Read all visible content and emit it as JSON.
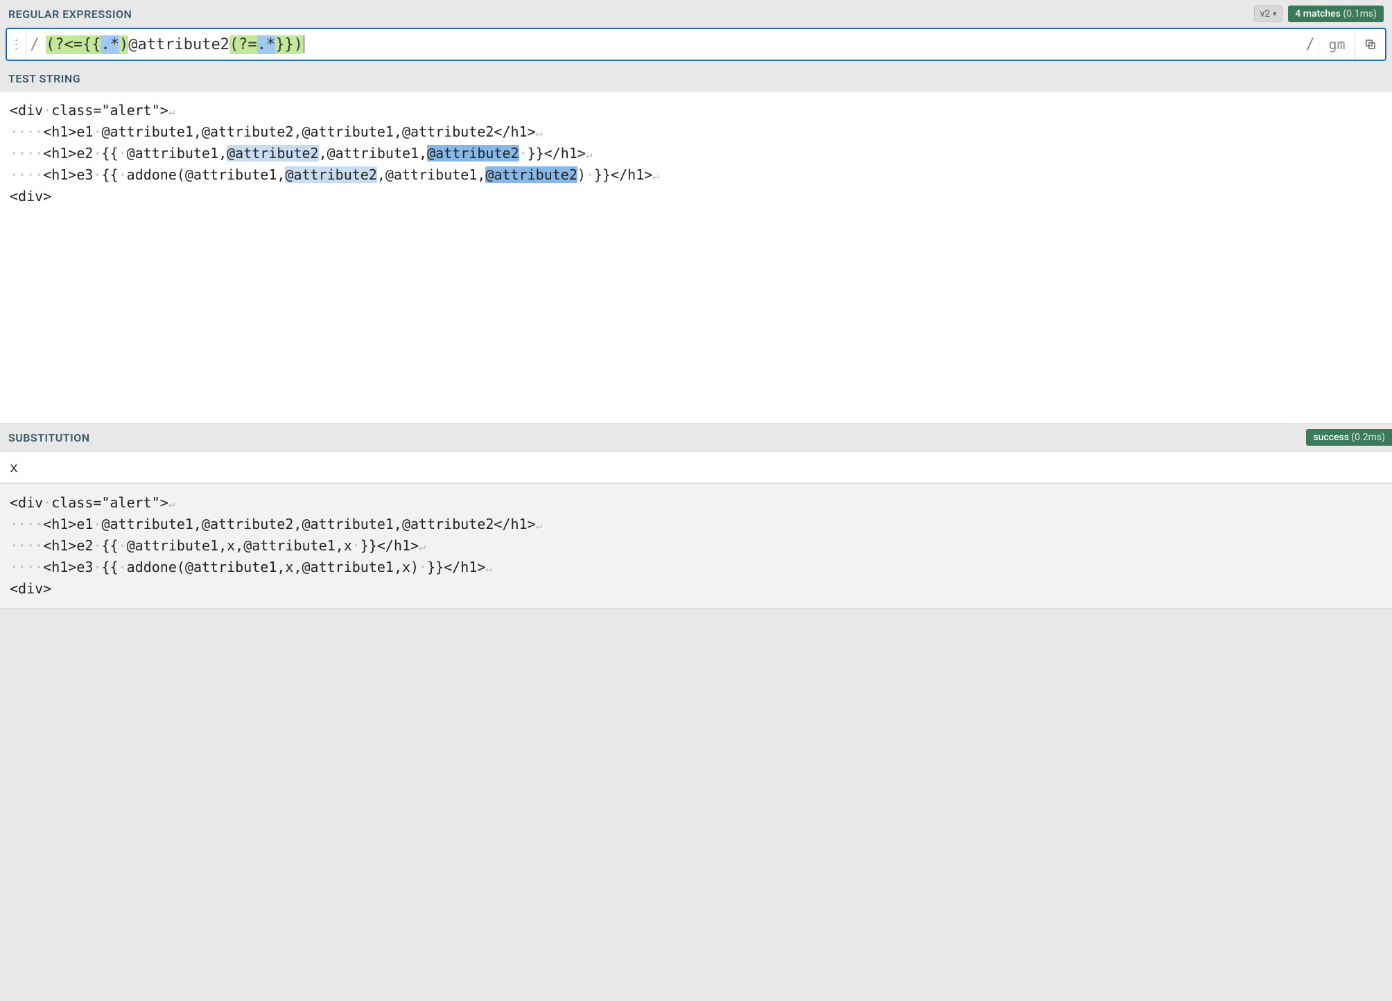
{
  "headers": {
    "regex": "REGULAR EXPRESSION",
    "test": "TEST STRING",
    "sub": "SUBSTITUTION"
  },
  "version": "v2",
  "matches": {
    "count": "4 matches",
    "time": "(0.1ms)"
  },
  "regex": {
    "delim_open": "/",
    "delim_close": "/",
    "flags": "gm",
    "parts": {
      "p1": "(?<={{",
      "p2": ".*",
      "p3": ")",
      "p4": "@attribute2",
      "p5": "(?=",
      "p6": ".*",
      "p7": "}})"
    }
  },
  "test_lines": [
    {
      "indent": 0,
      "pre": "<div",
      "sp1": true,
      "rest": "class=\"alert\">",
      "nl": true
    },
    {
      "indent": 4,
      "pre": "<h1>e1",
      "sp1": true,
      "segments": [
        {
          "t": "@attribute1,@attribute2,@attribute1,@attribute2</h1>"
        }
      ],
      "nl": true
    },
    {
      "indent": 4,
      "pre": "<h1>e2",
      "sp1": true,
      "segments": [
        {
          "t": "{{"
        },
        {
          "ws": true
        },
        {
          "t": "@attribute1,"
        },
        {
          "t": "@attribute2",
          "cls": "match-weak"
        },
        {
          "t": ",@attribute1,"
        },
        {
          "t": "@attribute2",
          "cls": "match-strong"
        },
        {
          "ws": true
        },
        {
          "t": "}}</h1>"
        }
      ],
      "nl": true
    },
    {
      "indent": 4,
      "pre": "<h1>e3",
      "sp1": true,
      "segments": [
        {
          "t": "{{"
        },
        {
          "ws": true
        },
        {
          "t": "addone(@attribute1,"
        },
        {
          "t": "@attribute2",
          "cls": "match-weak"
        },
        {
          "t": ",@attribute1,"
        },
        {
          "t": "@attribute2",
          "cls": "match-strong"
        },
        {
          "t": ")"
        },
        {
          "ws": true
        },
        {
          "t": "}}</h1>"
        }
      ],
      "nl": true
    },
    {
      "indent": 0,
      "pre": "<div>",
      "nl": false
    }
  ],
  "sub": {
    "input": "x",
    "status": "success",
    "time": "(0.2ms)"
  },
  "result_lines": [
    {
      "indent": 0,
      "pre": "<div",
      "sp1": true,
      "rest": "class=\"alert\">",
      "nl": true
    },
    {
      "indent": 4,
      "pre": "<h1>e1",
      "sp1": true,
      "segments": [
        {
          "t": "@attribute1,@attribute2,@attribute1,@attribute2</h1>"
        }
      ],
      "nl": true
    },
    {
      "indent": 4,
      "pre": "<h1>e2",
      "sp1": true,
      "segments": [
        {
          "t": "{{"
        },
        {
          "ws": true
        },
        {
          "t": "@attribute1,x,@attribute1,x"
        },
        {
          "ws": true
        },
        {
          "t": "}}</h1>"
        }
      ],
      "nl": true
    },
    {
      "indent": 4,
      "pre": "<h1>e3",
      "sp1": true,
      "segments": [
        {
          "t": "{{"
        },
        {
          "ws": true
        },
        {
          "t": "addone(@attribute1,x,@attribute1,x)"
        },
        {
          "ws": true
        },
        {
          "t": "}}</h1>"
        }
      ],
      "nl": true
    },
    {
      "indent": 0,
      "pre": "<div>",
      "nl": false
    }
  ]
}
